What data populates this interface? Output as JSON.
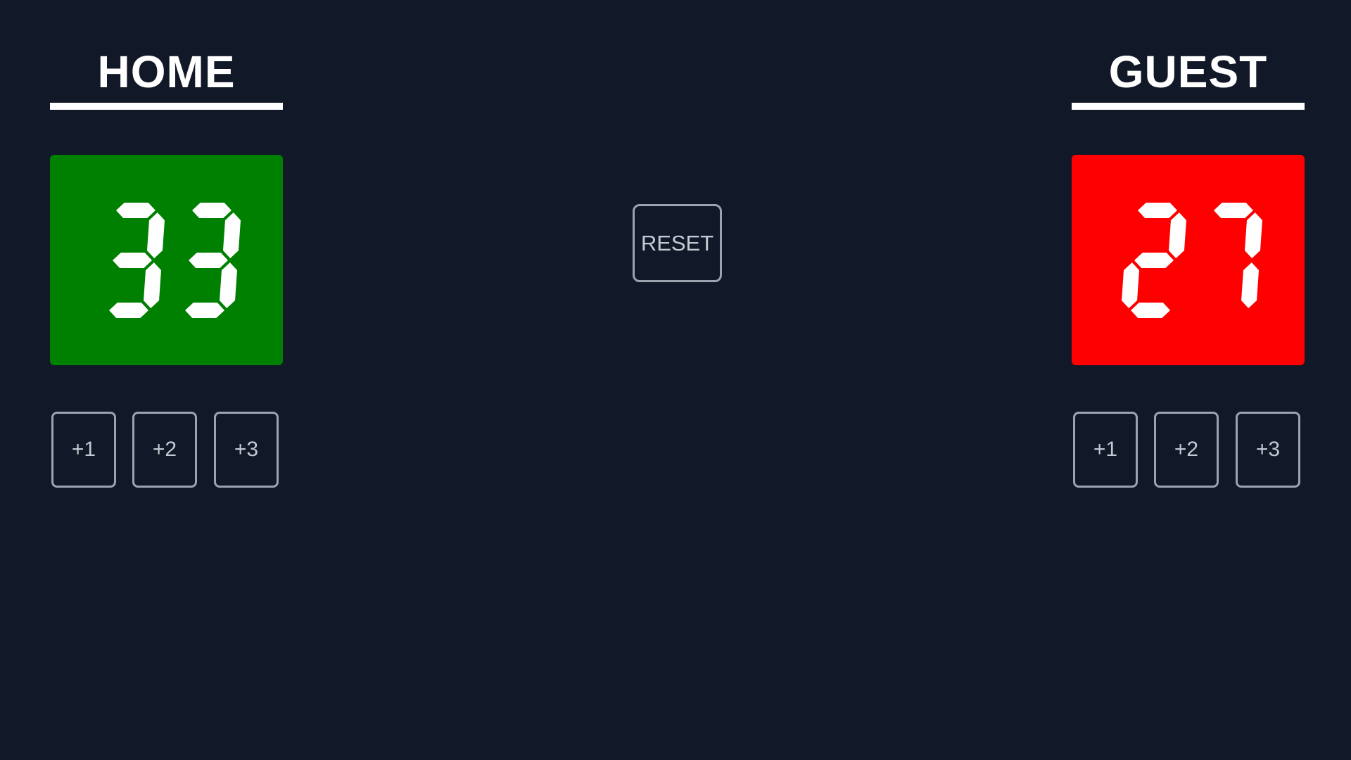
{
  "home": {
    "title": "HOME",
    "score": "33",
    "box_color": "#008000",
    "buttons": [
      "+1",
      "+2",
      "+3"
    ]
  },
  "guest": {
    "title": "GUEST",
    "score": "27",
    "box_color": "#ff0000",
    "buttons": [
      "+1",
      "+2",
      "+3"
    ]
  },
  "controls": {
    "reset_label": "RESET"
  },
  "colors": {
    "background": "#111827",
    "text": "#ffffff",
    "button_border": "#9ca3af"
  }
}
